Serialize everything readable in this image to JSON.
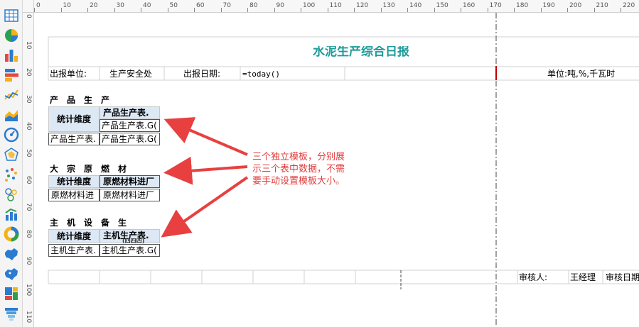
{
  "toolbar": {
    "icons": [
      "table-icon",
      "pie-chart-icon",
      "bar-chart-icon",
      "horizontal-bar-icon",
      "line-chart-icon",
      "area-chart-icon",
      "gauge-icon",
      "radar-chart-icon",
      "scatter-chart-icon",
      "bubble-chart-icon",
      "combo-chart-icon",
      "ring-chart-icon",
      "china-map-icon",
      "china-map-2-icon",
      "treemap-icon",
      "funnel-icon"
    ]
  },
  "ruler": {
    "h_ticks": [
      "0",
      "10",
      "20",
      "30",
      "40",
      "50",
      "60",
      "70",
      "80",
      "90",
      "100",
      "110",
      "120",
      "130",
      "140",
      "150",
      "160",
      "170",
      "180",
      "190",
      "200",
      "210",
      "220"
    ],
    "v_ticks": [
      "0",
      "10",
      "20",
      "30",
      "40",
      "50",
      "60",
      "70",
      "80",
      "90",
      "100",
      "110"
    ]
  },
  "report": {
    "title": "水泥生产综合日报",
    "unit_label": "出报单位:",
    "unit_value": "生产安全处",
    "date_label": "出报日期:",
    "date_value": "=today()",
    "measure_units": "单位:吨,%,千瓦时",
    "colors": {
      "title": "#1e9a9a",
      "header_bg": "#dde8f5",
      "annotation": "#e03c3c",
      "arrow": "#e84040"
    }
  },
  "templates": [
    {
      "section_title": "产　品　生　产",
      "dim_label": "统计维度",
      "header_cell": "产品生产表.",
      "value_cell": "产品生产表.G(",
      "row_cell_left": "产品生产表.",
      "row_cell_right": "产品生产表.G("
    },
    {
      "section_title": "大　宗　原　燃　材",
      "dim_label": "统计维度",
      "header_cell": "原燃材料进厂",
      "row_cell_left": "原燃材料进",
      "row_cell_right": "原燃材料进厂"
    },
    {
      "section_title": "主　机　设　备　生",
      "dim_label": "统计维度",
      "header_cell": "主机生产表.",
      "header_cell_sub": "(四四四)",
      "row_cell_left": "主机生产表.",
      "row_cell_right": "主机生产表.G("
    }
  ],
  "annotation": {
    "lines": [
      "三个独立模板，分别展",
      "示三个表中数据，不需",
      "要手动设置模板大小。"
    ]
  },
  "footer": {
    "reviewer_label": "审核人:",
    "reviewer_value": "王经理",
    "review_date_label": "审核日期"
  }
}
